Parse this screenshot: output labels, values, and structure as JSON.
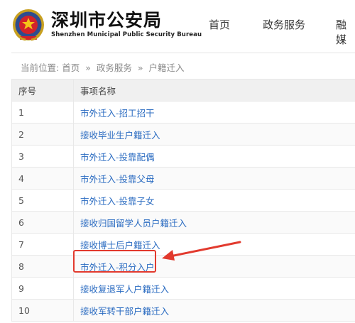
{
  "header": {
    "title": "深圳市公安局",
    "subtitle": "Shenzhen Municipal Public Security Bureau",
    "nav": [
      "首页",
      "政务服务",
      "融媒"
    ]
  },
  "breadcrumb": {
    "prefix": "当前位置:",
    "items": [
      "首页",
      "政务服务",
      "户籍迁入"
    ],
    "separator": "»"
  },
  "table": {
    "headers": [
      "序号",
      "事项名称"
    ],
    "rows": [
      {
        "no": "1",
        "name": "市外迁入-招工招干"
      },
      {
        "no": "2",
        "name": "接收毕业生户籍迁入"
      },
      {
        "no": "3",
        "name": "市外迁入-投靠配偶"
      },
      {
        "no": "4",
        "name": "市外迁入-投靠父母"
      },
      {
        "no": "5",
        "name": "市外迁入-投靠子女"
      },
      {
        "no": "6",
        "name": "接收归国留学人员户籍迁入"
      },
      {
        "no": "7",
        "name": "接收博士后户籍迁入"
      },
      {
        "no": "8",
        "name": "市外迁入-积分入户"
      },
      {
        "no": "9",
        "name": "接收复退军人户籍迁入"
      },
      {
        "no": "10",
        "name": "接收军转干部户籍迁入"
      }
    ]
  },
  "colors": {
    "link": "#2a6bc1",
    "annotation": "#e23a2e",
    "header_bg": "#f0f0f0"
  },
  "icons": {
    "emblem": "police-emblem-icon"
  }
}
